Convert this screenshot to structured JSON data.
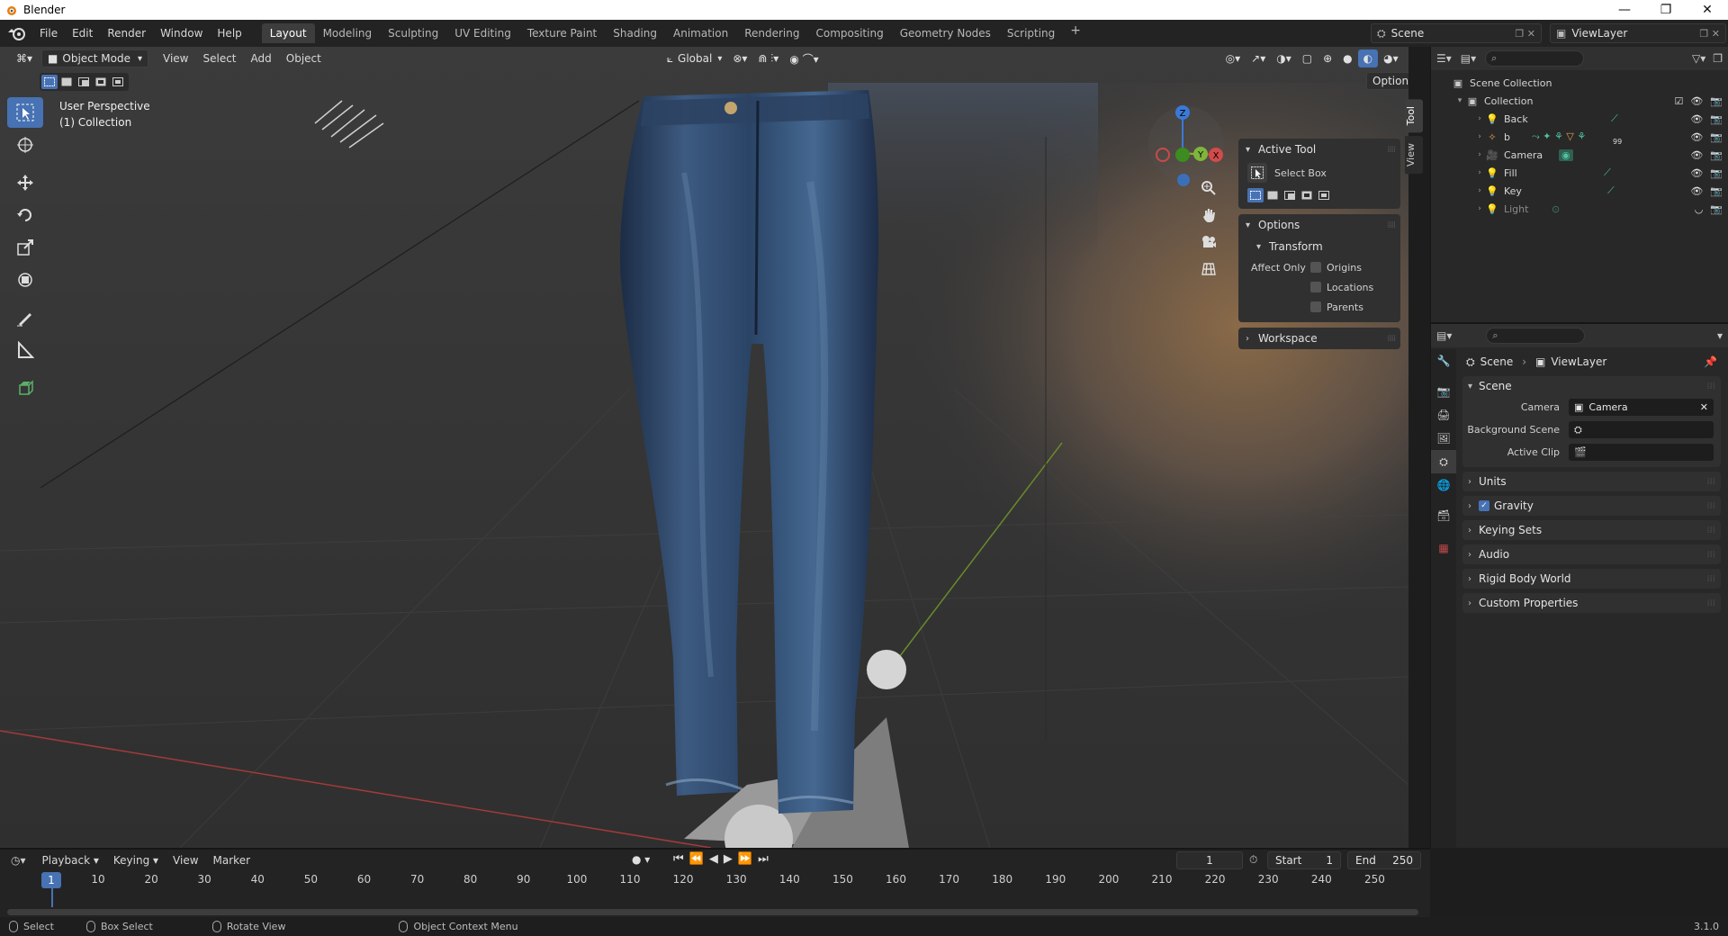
{
  "window": {
    "title": "Blender",
    "controls": [
      "—",
      "❐",
      "✕"
    ]
  },
  "menus": [
    "File",
    "Edit",
    "Render",
    "Window",
    "Help"
  ],
  "workspaces": [
    {
      "label": "Layout",
      "active": true
    },
    {
      "label": "Modeling"
    },
    {
      "label": "Sculpting"
    },
    {
      "label": "UV Editing"
    },
    {
      "label": "Texture Paint"
    },
    {
      "label": "Shading"
    },
    {
      "label": "Animation"
    },
    {
      "label": "Rendering"
    },
    {
      "label": "Compositing"
    },
    {
      "label": "Geometry Nodes"
    },
    {
      "label": "Scripting"
    }
  ],
  "scene": {
    "name": "Scene",
    "view_layer": "ViewLayer"
  },
  "viewport": {
    "mode": "Object Mode",
    "menus": [
      "View",
      "Select",
      "Add",
      "Object"
    ],
    "orientation": "Global",
    "options_label": "Options",
    "info_line1": "User Perspective",
    "info_line2": "(1) Collection",
    "gizmo_axes": {
      "z": "Z",
      "y": "Y",
      "x": "X"
    }
  },
  "npanel": {
    "active_tool_title": "Active Tool",
    "tool_name": "Select Box",
    "options_title": "Options",
    "transform_title": "Transform",
    "affect_only_label": "Affect Only",
    "affect_items": [
      "Origins",
      "Locations",
      "Parents"
    ],
    "workspace_title": "Workspace",
    "tabs": [
      "Tool",
      "View"
    ]
  },
  "outliner": {
    "root": "Scene Collection",
    "collection": "Collection",
    "objects": [
      {
        "name": "Back",
        "type": "light"
      },
      {
        "name": "b",
        "type": "armature",
        "badge": "99"
      },
      {
        "name": "Camera",
        "type": "camera"
      },
      {
        "name": "Fill",
        "type": "light"
      },
      {
        "name": "Key",
        "type": "light"
      },
      {
        "name": "Light",
        "type": "light",
        "dim": true
      }
    ]
  },
  "properties": {
    "breadcrumb_scene": "Scene",
    "breadcrumb_layer": "ViewLayer",
    "scene_panel": "Scene",
    "camera_label": "Camera",
    "camera_value": "Camera",
    "bg_scene_label": "Background Scene",
    "active_clip_label": "Active Clip",
    "panels": [
      "Units",
      "Gravity",
      "Keying Sets",
      "Audio",
      "Rigid Body World",
      "Custom Properties"
    ]
  },
  "timeline": {
    "menus": [
      "Playback",
      "Keying",
      "View",
      "Marker"
    ],
    "current_frame": "1",
    "start_label": "Start",
    "start": "1",
    "end_label": "End",
    "end": "250",
    "ticks": [
      "10",
      "20",
      "30",
      "40",
      "50",
      "60",
      "70",
      "80",
      "90",
      "100",
      "110",
      "120",
      "130",
      "140",
      "150",
      "160",
      "170",
      "180",
      "190",
      "200",
      "210",
      "220",
      "230",
      "240",
      "250"
    ],
    "marker_frame": "1"
  },
  "statusbar": {
    "items": [
      "Select",
      "Box Select",
      "Rotate View",
      "Object Context Menu"
    ],
    "version": "3.1.0"
  },
  "colors": {
    "accent": "#4772b3",
    "viewport_bg": "#3a3a3a",
    "panel": "#303030"
  }
}
